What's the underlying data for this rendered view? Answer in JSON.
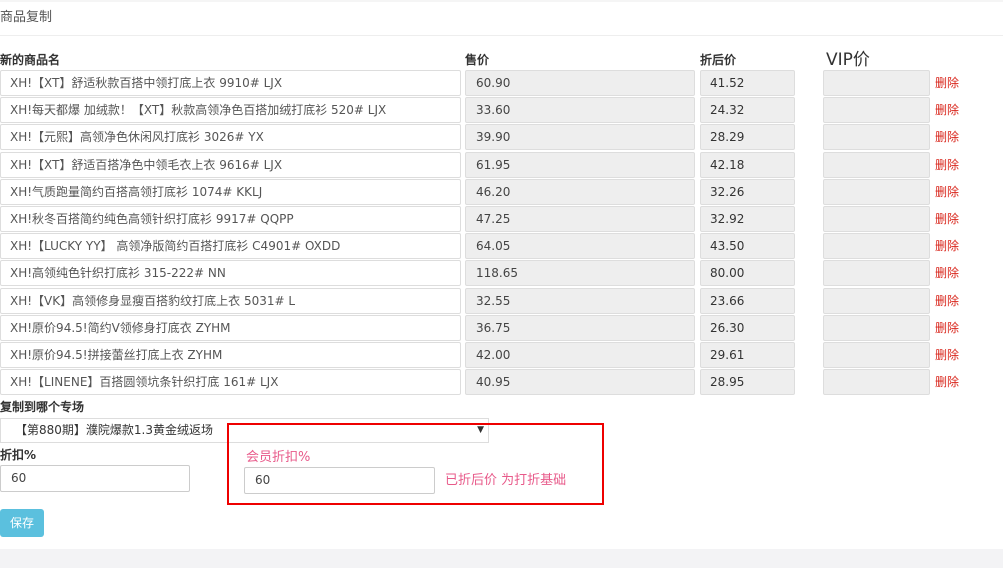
{
  "panel": {
    "title": "商品复制"
  },
  "headers": {
    "name": "新的商品名",
    "price": "售价",
    "discount": "折后价",
    "vip": "VIP价"
  },
  "rows": [
    {
      "name": "XH!【XT】舒适秋款百搭中领打底上衣 9910# LJX",
      "price": "60.90",
      "discount": "41.52",
      "vip": "",
      "delete": "删除"
    },
    {
      "name": "XH!每天都爆 加绒款！【XT】秋款高领净色百搭加绒打底衫 520# LJX",
      "price": "33.60",
      "discount": "24.32",
      "vip": "",
      "delete": "删除"
    },
    {
      "name": "XH!【元熙】高领净色休闲风打底衫 3026#  YX",
      "price": "39.90",
      "discount": "28.29",
      "vip": "",
      "delete": "删除"
    },
    {
      "name": "XH!【XT】舒适百搭净色中领毛衣上衣 9616# LJX",
      "price": "61.95",
      "discount": "42.18",
      "vip": "",
      "delete": "删除"
    },
    {
      "name": "XH!气质跑量简约百搭高领打底衫 1074# KKLJ",
      "price": "46.20",
      "discount": "32.26",
      "vip": "",
      "delete": "删除"
    },
    {
      "name": "XH!秋冬百搭简约纯色高领针织打底衫 9917# QQPP",
      "price": "47.25",
      "discount": "32.92",
      "vip": "",
      "delete": "删除"
    },
    {
      "name": "XH!【LUCKY YY】 高领净版简约百搭打底衫 C4901# OXDD",
      "price": "64.05",
      "discount": "43.50",
      "vip": "",
      "delete": "删除"
    },
    {
      "name": "XH!高领纯色针织打底衫 315-222# NN",
      "price": "118.65",
      "discount": "80.00",
      "vip": "",
      "delete": "删除"
    },
    {
      "name": "XH!【VK】高领修身显瘦百搭豹纹打底上衣 5031# L",
      "price": "32.55",
      "discount": "23.66",
      "vip": "",
      "delete": "删除"
    },
    {
      "name": "XH!原价94.5!简约V领修身打底衣 ZYHM",
      "price": "36.75",
      "discount": "26.30",
      "vip": "",
      "delete": "删除"
    },
    {
      "name": "XH!原价94.5!拼接蕾丝打底上衣 ZYHM",
      "price": "42.00",
      "discount": "29.61",
      "vip": "",
      "delete": "删除"
    },
    {
      "name": "XH!【LINENE】百搭圆领坑条针织打底 161# LJX",
      "price": "40.95",
      "discount": "28.95",
      "vip": "",
      "delete": "删除"
    }
  ],
  "copy_to": {
    "label": "复制到哪个专场",
    "selected": "【第880期】濮院爆款1.3黄金绒返场"
  },
  "discount_field": {
    "label": "折扣%",
    "value": "60"
  },
  "member_discount": {
    "label": "会员折扣%",
    "value": "60",
    "note": "已折后价 为打折基础"
  },
  "save_label": "保存",
  "colors": {
    "delete": "#d9261c",
    "save_bg": "#5bc0de",
    "highlight_border": "#e00000",
    "pink_text": "#e85a8a"
  }
}
